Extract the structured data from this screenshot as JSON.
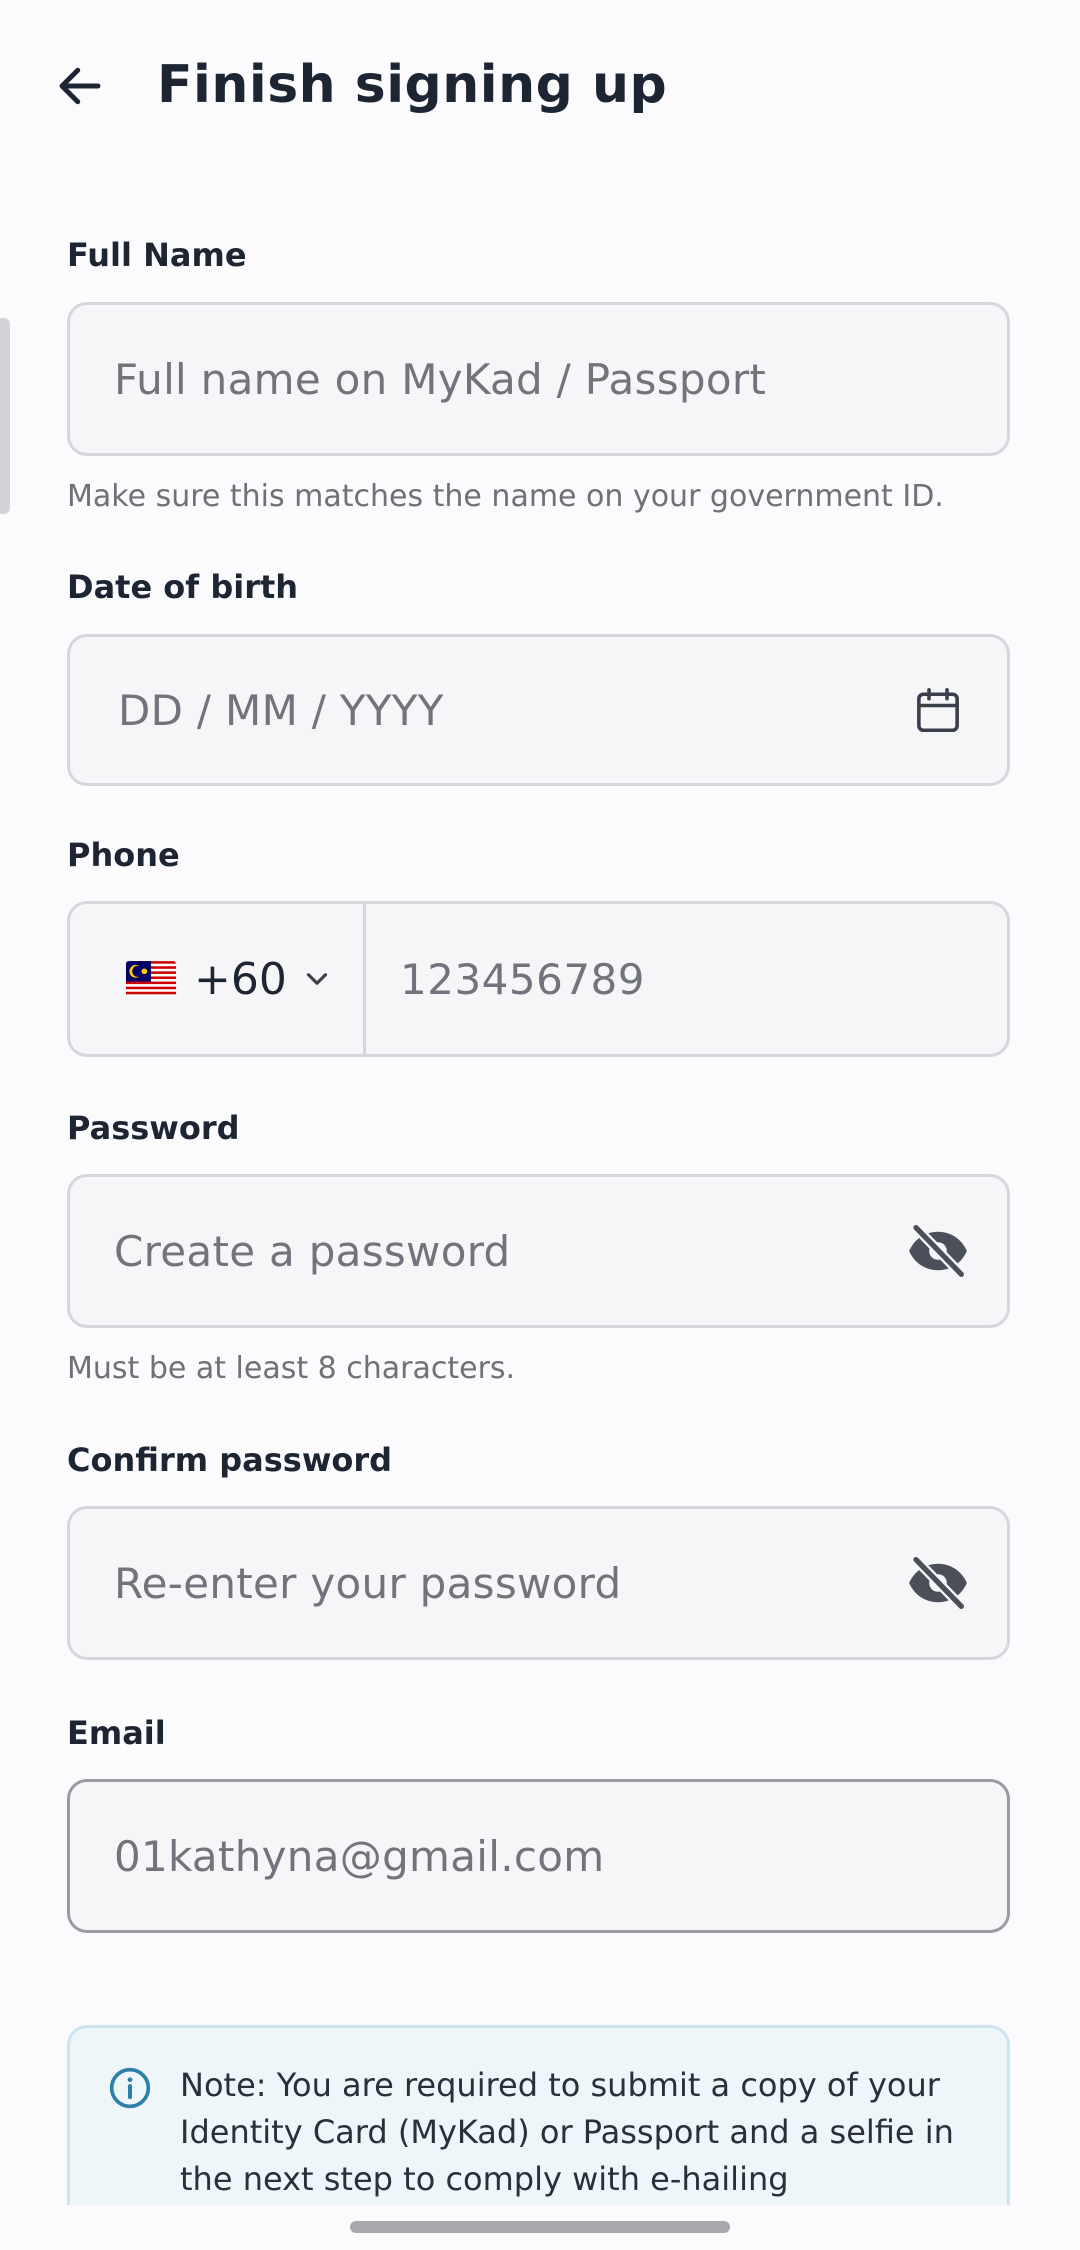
{
  "header": {
    "title": "Finish signing up",
    "back_icon": "arrow-left-icon"
  },
  "form": {
    "full_name": {
      "label": "Full Name",
      "placeholder": "Full name on MyKad / Passport",
      "helper": "Make sure this matches the name on your government ID."
    },
    "dob": {
      "label": "Date of birth",
      "placeholder": "DD / MM / YYYY",
      "icon": "calendar-icon"
    },
    "phone": {
      "label": "Phone",
      "country_flag": "malaysia-flag-icon",
      "dial_code": "+60",
      "placeholder": "123456789"
    },
    "password": {
      "label": "Password",
      "placeholder": "Create a password",
      "helper": "Must be at least 8 characters.",
      "icon": "eye-off-icon"
    },
    "confirm_password": {
      "label": "Confirm password",
      "placeholder": "Re-enter your password",
      "icon": "eye-off-icon"
    },
    "email": {
      "label": "Email",
      "value": "01kathyna@gmail.com"
    }
  },
  "note": {
    "icon": "info-icon",
    "text": "Note: You are required to submit a copy of your Identity Card (MyKad) or Passport and a selfie in the next step to comply with e-hailing"
  },
  "colors": {
    "background": "#fbfbfd",
    "text": "#1e2532",
    "placeholder": "#72747d",
    "field_bg": "#f6f6f8",
    "field_border": "#d6d7dc",
    "note_bg": "#eef6fa",
    "info_accent": "#2b7fa8"
  }
}
